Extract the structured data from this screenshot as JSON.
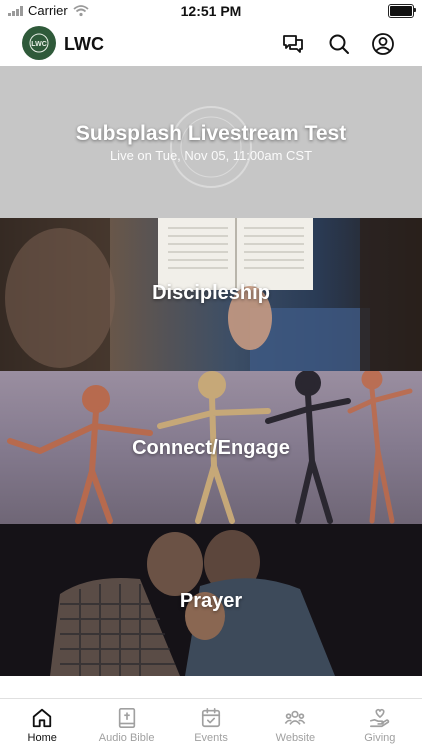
{
  "status_bar": {
    "carrier": "Carrier",
    "time": "12:51 PM"
  },
  "header": {
    "app_name": "LWC",
    "logo_text": "LWC"
  },
  "tiles": [
    {
      "title": "Subsplash Livestream Test",
      "subtitle": "Live on Tue, Nov 05, 11:00am CST"
    },
    {
      "title": "Discipleship"
    },
    {
      "title": "Connect/Engage"
    },
    {
      "title": "Prayer"
    }
  ],
  "tabs": [
    {
      "label": "Home",
      "icon": "home-icon",
      "active": true
    },
    {
      "label": "Audio Bible",
      "icon": "bible-icon"
    },
    {
      "label": "Events",
      "icon": "calendar-icon"
    },
    {
      "label": "Website",
      "icon": "people-icon"
    },
    {
      "label": "Giving",
      "icon": "giving-icon"
    }
  ],
  "colors": {
    "tab_active": "#111111",
    "tab_inactive": "#a0a0a0",
    "logo_bg": "#2f5a3a"
  }
}
